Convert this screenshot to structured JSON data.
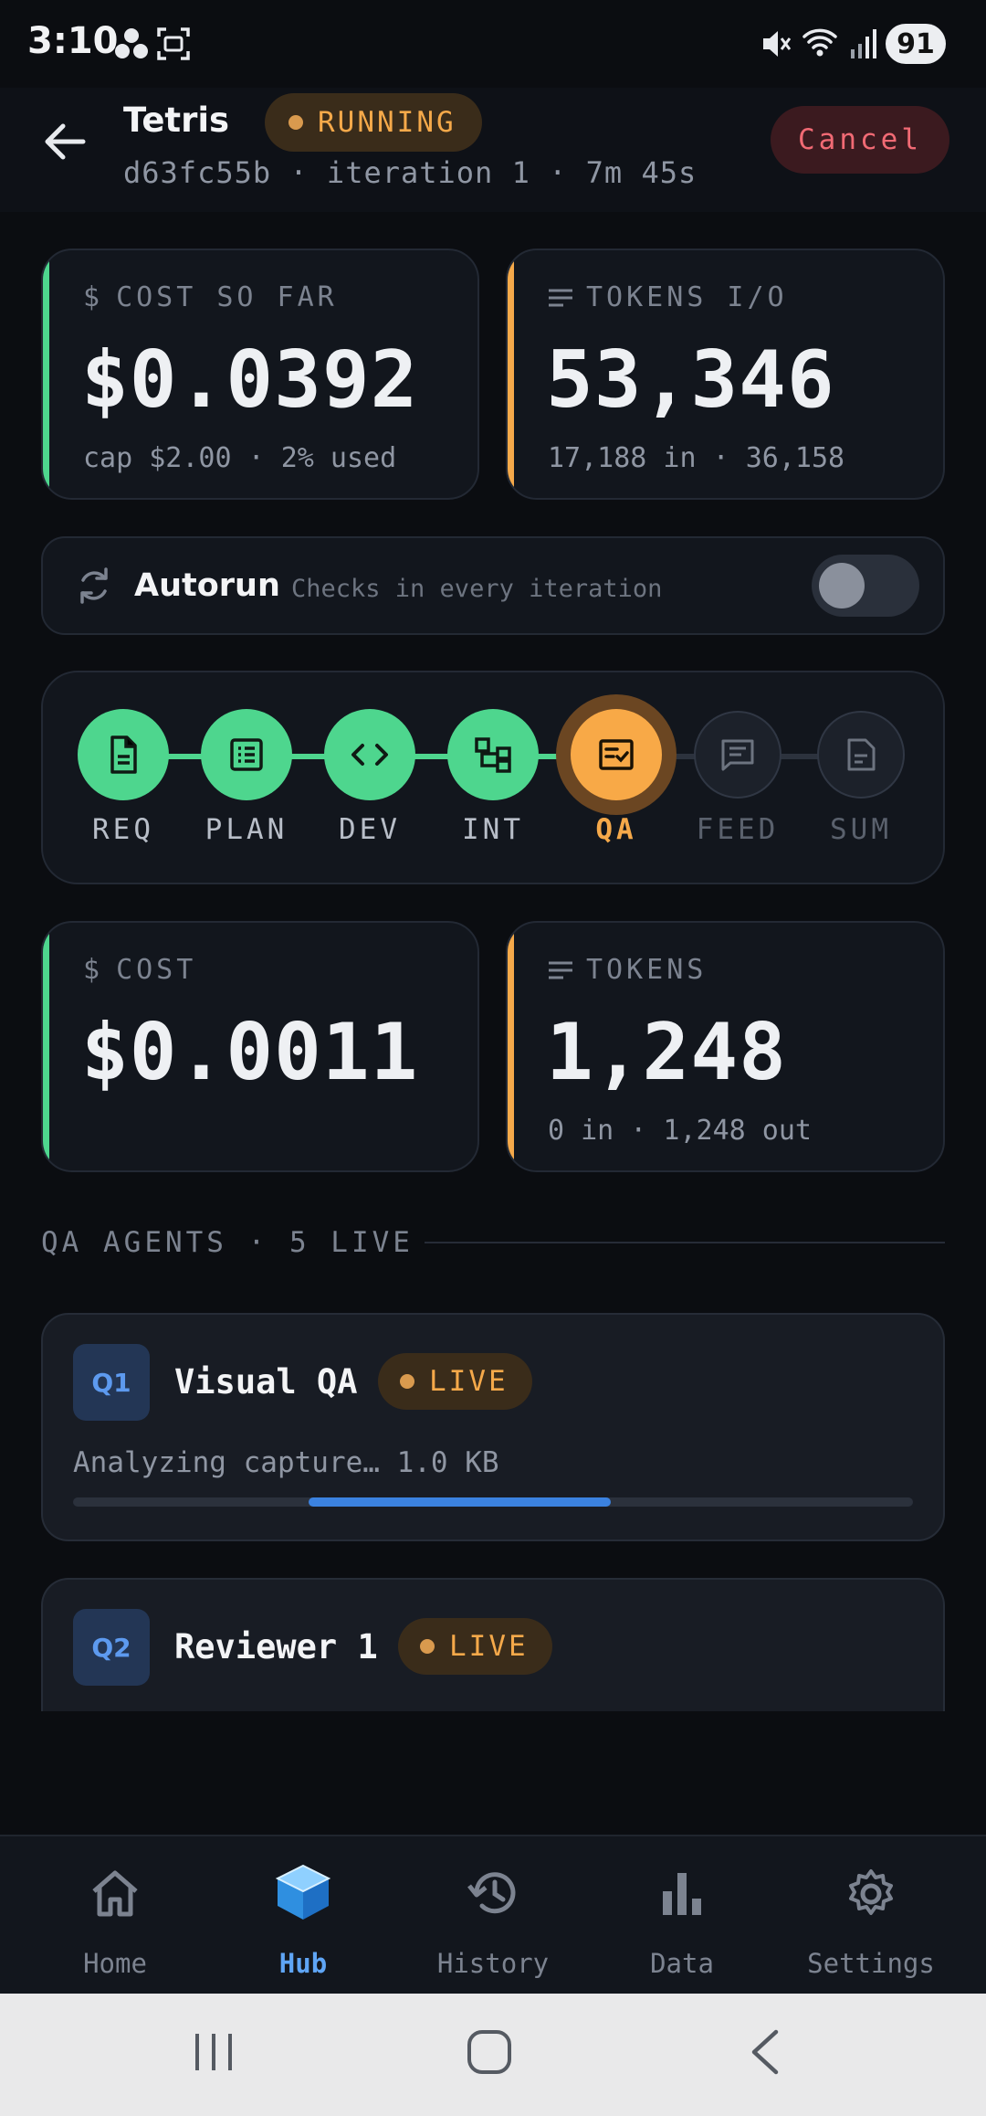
{
  "status_bar": {
    "time": "3:10",
    "battery": "91"
  },
  "header": {
    "title": "Tetris",
    "status": "RUNNING",
    "subtitle": "d63fc55b · iteration 1 · 7m 45s",
    "cancel_label": "Cancel"
  },
  "totals": {
    "cost": {
      "label": "COST SO FAR",
      "value": "$0.0392",
      "sub": "cap $2.00 · 2% used",
      "accent": "#4ed68e"
    },
    "tokens": {
      "label": "TOKENS I/O",
      "value": "53,346",
      "sub": "17,188 in · 36,158",
      "accent": "#f5a94a"
    }
  },
  "autorun": {
    "title": "Autorun",
    "description": "Checks in every iteration",
    "enabled": false
  },
  "pipeline": {
    "steps": [
      {
        "label": "REQ",
        "state": "done",
        "icon": "document-icon"
      },
      {
        "label": "PLAN",
        "state": "done",
        "icon": "list-icon"
      },
      {
        "label": "DEV",
        "state": "done",
        "icon": "code-icon"
      },
      {
        "label": "INT",
        "state": "done",
        "icon": "integration-icon"
      },
      {
        "label": "QA",
        "state": "active",
        "icon": "checklist-icon"
      },
      {
        "label": "FEED",
        "state": "todo",
        "icon": "feedback-icon"
      },
      {
        "label": "SUM",
        "state": "todo",
        "icon": "summary-icon"
      }
    ]
  },
  "stage": {
    "cost": {
      "label": "COST",
      "value": "$0.0011"
    },
    "tokens": {
      "label": "TOKENS",
      "value": "1,248",
      "sub": "0 in · 1,248 out"
    }
  },
  "agents_section": {
    "title": "QA AGENTS · 5 LIVE"
  },
  "agents": [
    {
      "id": "Q1",
      "name": "Visual QA",
      "badge": "LIVE",
      "status": "Analyzing capture… 1.0 KB",
      "progress": {
        "start": 0.28,
        "end": 0.64
      }
    },
    {
      "id": "Q2",
      "name": "Reviewer 1",
      "badge": "LIVE"
    }
  ],
  "nav": {
    "items": [
      {
        "label": "Home",
        "icon": "home-icon"
      },
      {
        "label": "Hub",
        "icon": "hub-cube-icon",
        "active": true
      },
      {
        "label": "History",
        "icon": "history-icon"
      },
      {
        "label": "Data",
        "icon": "bar-chart-icon"
      },
      {
        "label": "Settings",
        "icon": "gear-icon"
      }
    ]
  },
  "colors": {
    "done": "#4ed68e",
    "active": "#f8a947",
    "accent_blue": "#5fa5f5",
    "danger": "#f16a74"
  }
}
